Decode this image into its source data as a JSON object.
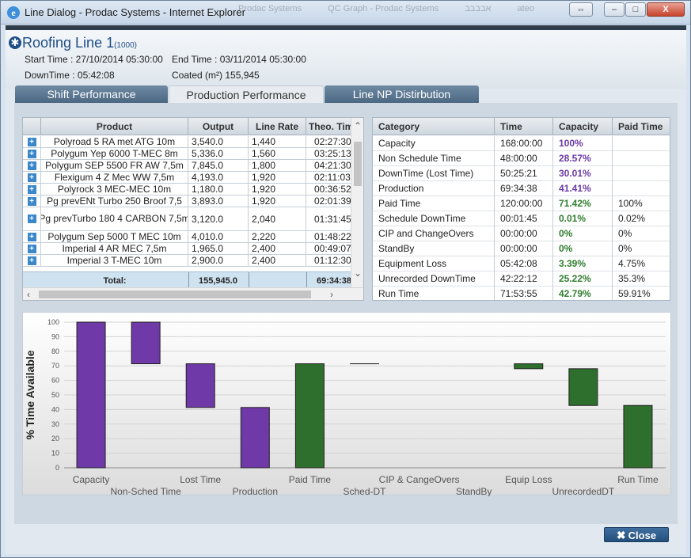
{
  "window": {
    "title": "Line Dialog - Prodac Systems - Internet Explorer",
    "background_tabs": [
      "Prodac Systems",
      "QC Graph - Prodac Systems",
      "אבבבב",
      "ateo"
    ],
    "controls": [
      "⇔",
      "–",
      "□",
      "X"
    ]
  },
  "header": {
    "line_name": "Roofing Line 1",
    "line_number": "(1000)",
    "start_time": "Start Time : 27/10/2014 05:30:00",
    "end_time": "End Time : 03/11/2014 05:30:00",
    "downtime": "DownTime : 05:42:08",
    "coated": "Coated (m²) 155,945"
  },
  "tabs": [
    "Shift Performance",
    "Production Performance",
    "Line NP Distirbution"
  ],
  "active_tab": 1,
  "products": {
    "columns": [
      "",
      "Product",
      "Output",
      "Line Rate",
      "Theo. Time"
    ],
    "rows": [
      {
        "product": "Polyroad 5 RA met ATG 10m",
        "output": "3,540.0",
        "rate": "1,440",
        "theo": "02:27:30"
      },
      {
        "product": "Polygum Yep 6000 T-MEC 8m",
        "output": "5,336.0",
        "rate": "1,560",
        "theo": "03:25:13"
      },
      {
        "product": "Polygum SEP 5500 FR AW 7,5m",
        "output": "7,845.0",
        "rate": "1,800",
        "theo": "04:21:30"
      },
      {
        "product": "Flexigum 4 Z Mec WW 7,5m",
        "output": "4,193.0",
        "rate": "1,920",
        "theo": "02:11:03"
      },
      {
        "product": "Polyrock 3 MEC-MEC 10m",
        "output": "1,180.0",
        "rate": "1,920",
        "theo": "00:36:52"
      },
      {
        "product": "Pg prevENt Turbo 250 Broof 7,5",
        "output": "3,893.0",
        "rate": "1,920",
        "theo": "02:01:39"
      },
      {
        "product": "Pg prevTurbo 180 4 CARBON 7,5m",
        "output": "3,120.0",
        "rate": "2,040",
        "theo": "01:31:45"
      },
      {
        "product": "Polygum Sep 5000 T MEC 10m",
        "output": "4,010.0",
        "rate": "2,220",
        "theo": "01:48:22"
      },
      {
        "product": "Imperial 4 AR MEC 7,5m",
        "output": "1,965.0",
        "rate": "2,400",
        "theo": "00:49:07"
      },
      {
        "product": "Imperial 3 T-MEC 10m",
        "output": "2,900.0",
        "rate": "2,400",
        "theo": "01:12:30"
      }
    ],
    "total_label": "Total:",
    "total_output": "155,945.0",
    "total_theo": "69:34:38"
  },
  "categories": {
    "columns": [
      "Category",
      "Time",
      "Capacity",
      "Paid Time"
    ],
    "rows": [
      {
        "category": "Capacity",
        "time": "168:00:00",
        "capacity": "100%",
        "paid": "",
        "tone": "purple"
      },
      {
        "category": "Non Schedule Time",
        "time": "48:00:00",
        "capacity": "28.57%",
        "paid": "",
        "tone": "purple"
      },
      {
        "category": "DownTime (Lost Time)",
        "time": "50:25:21",
        "capacity": "30.01%",
        "paid": "",
        "tone": "purple"
      },
      {
        "category": "Production",
        "time": "69:34:38",
        "capacity": "41.41%",
        "paid": "",
        "tone": "purple"
      },
      {
        "category": "Paid Time",
        "time": "120:00:00",
        "capacity": "71.42%",
        "paid": "100%",
        "tone": "green"
      },
      {
        "category": "Schedule DownTime",
        "time": "00:01:45",
        "capacity": "0.01%",
        "paid": "0.02%",
        "tone": "green"
      },
      {
        "category": "CIP and ChangeOvers",
        "time": "00:00:00",
        "capacity": "0%",
        "paid": "0%",
        "tone": "green"
      },
      {
        "category": "StandBy",
        "time": "00:00:00",
        "capacity": "0%",
        "paid": "0%",
        "tone": "green"
      },
      {
        "category": "Equipment Loss",
        "time": "05:42:08",
        "capacity": "3.39%",
        "paid": "4.75%",
        "tone": "green"
      },
      {
        "category": "Unrecorded DownTime",
        "time": "42:22:12",
        "capacity": "25.22%",
        "paid": "35.3%",
        "tone": "green"
      },
      {
        "category": "Run Time",
        "time": "71:53:55",
        "capacity": "42.79%",
        "paid": "59.91%",
        "tone": "green"
      }
    ]
  },
  "chart_data": {
    "type": "bar",
    "subtype": "waterfall",
    "ylabel": "% Time Available",
    "ylim": [
      0,
      100
    ],
    "yticks": [
      0,
      10,
      20,
      30,
      40,
      50,
      60,
      70,
      80,
      90,
      100
    ],
    "grid": true,
    "categories": [
      "Capacity",
      "Non-Sched Time",
      "Lost Time",
      "Production",
      "Paid Time",
      "Sched-DT",
      "CIP & CangeOvers",
      "StandBy",
      "Equip Loss",
      "UnrecordedDT",
      "Run Time"
    ],
    "bars": [
      {
        "category": "Capacity",
        "bottom": 0,
        "top": 100,
        "color": "#6f3aa8"
      },
      {
        "category": "Non-Sched Time",
        "bottom": 71.43,
        "top": 100,
        "color": "#6f3aa8"
      },
      {
        "category": "Lost Time",
        "bottom": 41.41,
        "top": 71.42,
        "color": "#6f3aa8"
      },
      {
        "category": "Production",
        "bottom": 0,
        "top": 41.41,
        "color": "#6f3aa8"
      },
      {
        "category": "Paid Time",
        "bottom": 0,
        "top": 71.42,
        "color": "#2e6f2e"
      },
      {
        "category": "Sched-DT",
        "bottom": 71.41,
        "top": 71.42,
        "color": "#2e6f2e"
      },
      {
        "category": "CIP & CangeOvers",
        "bottom": 71.41,
        "top": 71.41,
        "color": "#2e6f2e"
      },
      {
        "category": "StandBy",
        "bottom": 71.41,
        "top": 71.41,
        "color": "#2e6f2e"
      },
      {
        "category": "Equip Loss",
        "bottom": 68.02,
        "top": 71.41,
        "color": "#2e6f2e"
      },
      {
        "category": "UnrecordedDT",
        "bottom": 42.8,
        "top": 68.02,
        "color": "#2e6f2e"
      },
      {
        "category": "Run Time",
        "bottom": 0,
        "top": 42.79,
        "color": "#2e6f2e"
      }
    ]
  },
  "close_button": {
    "label": "Close",
    "icon": "✖"
  }
}
